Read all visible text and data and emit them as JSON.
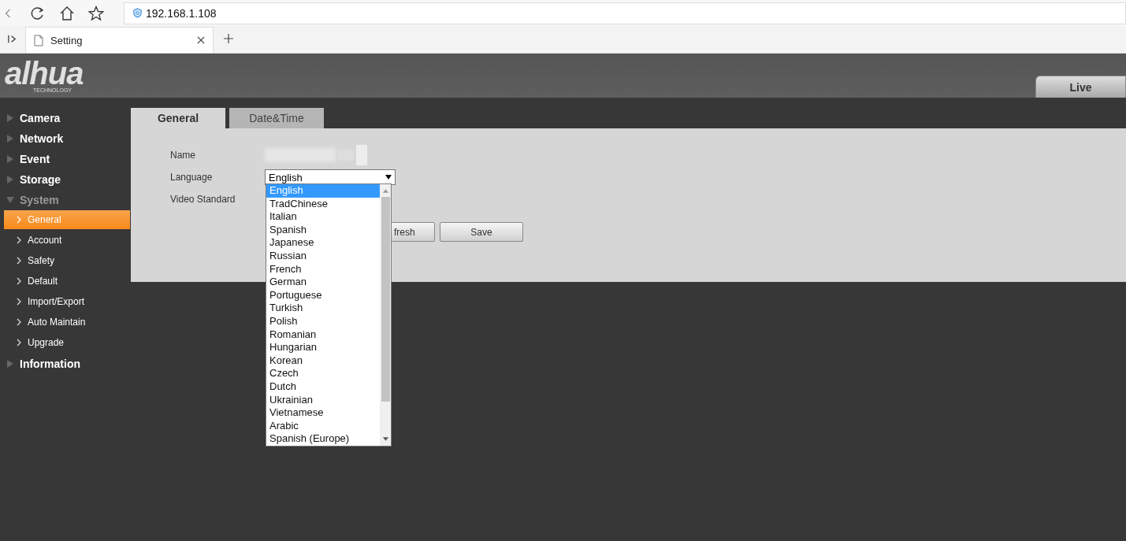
{
  "browser": {
    "address": "192.168.1.108",
    "tabs": [
      {
        "title": "Setting",
        "selected": true
      }
    ]
  },
  "header": {
    "logo": "alhua",
    "logo_sub": "TECHNOLOGY",
    "nav": [
      {
        "label": "Live",
        "selected": false
      }
    ]
  },
  "sidebar": {
    "items": [
      {
        "label": "Camera",
        "expanded": false
      },
      {
        "label": "Network",
        "expanded": false
      },
      {
        "label": "Event",
        "expanded": false
      },
      {
        "label": "Storage",
        "expanded": false
      },
      {
        "label": "System",
        "expanded": true,
        "children": [
          {
            "label": "General",
            "selected": true
          },
          {
            "label": "Account",
            "selected": false
          },
          {
            "label": "Safety",
            "selected": false
          },
          {
            "label": "Default",
            "selected": false
          },
          {
            "label": "Import/Export",
            "selected": false
          },
          {
            "label": "Auto Maintain",
            "selected": false
          },
          {
            "label": "Upgrade",
            "selected": false
          }
        ]
      },
      {
        "label": "Information",
        "expanded": false
      }
    ]
  },
  "tabs": [
    {
      "label": "General",
      "selected": true
    },
    {
      "label": "Date&Time",
      "selected": false
    }
  ],
  "form": {
    "fields": [
      {
        "label": "Name",
        "kind": "blurred"
      },
      {
        "label": "Language",
        "kind": "select",
        "value": "English"
      },
      {
        "label": "Video Standard",
        "kind": "hidden"
      }
    ],
    "buttons": [
      "fresh",
      "Save"
    ]
  },
  "dropdown": {
    "options": [
      {
        "label": "English",
        "selected": true
      },
      {
        "label": "TradChinese",
        "selected": false
      },
      {
        "label": "Italian",
        "selected": false
      },
      {
        "label": "Spanish",
        "selected": false
      },
      {
        "label": "Japanese",
        "selected": false
      },
      {
        "label": "Russian",
        "selected": false
      },
      {
        "label": "French",
        "selected": false
      },
      {
        "label": "German",
        "selected": false
      },
      {
        "label": "Portuguese",
        "selected": false
      },
      {
        "label": "Turkish",
        "selected": false
      },
      {
        "label": "Polish",
        "selected": false
      },
      {
        "label": "Romanian",
        "selected": false
      },
      {
        "label": "Hungarian",
        "selected": false
      },
      {
        "label": "Korean",
        "selected": false
      },
      {
        "label": "Czech",
        "selected": false
      },
      {
        "label": "Dutch",
        "selected": false
      },
      {
        "label": "Ukrainian",
        "selected": false
      },
      {
        "label": "Vietnamese",
        "selected": false
      },
      {
        "label": "Arabic",
        "selected": false
      },
      {
        "label": "Spanish (Europe)",
        "selected": false
      }
    ]
  }
}
